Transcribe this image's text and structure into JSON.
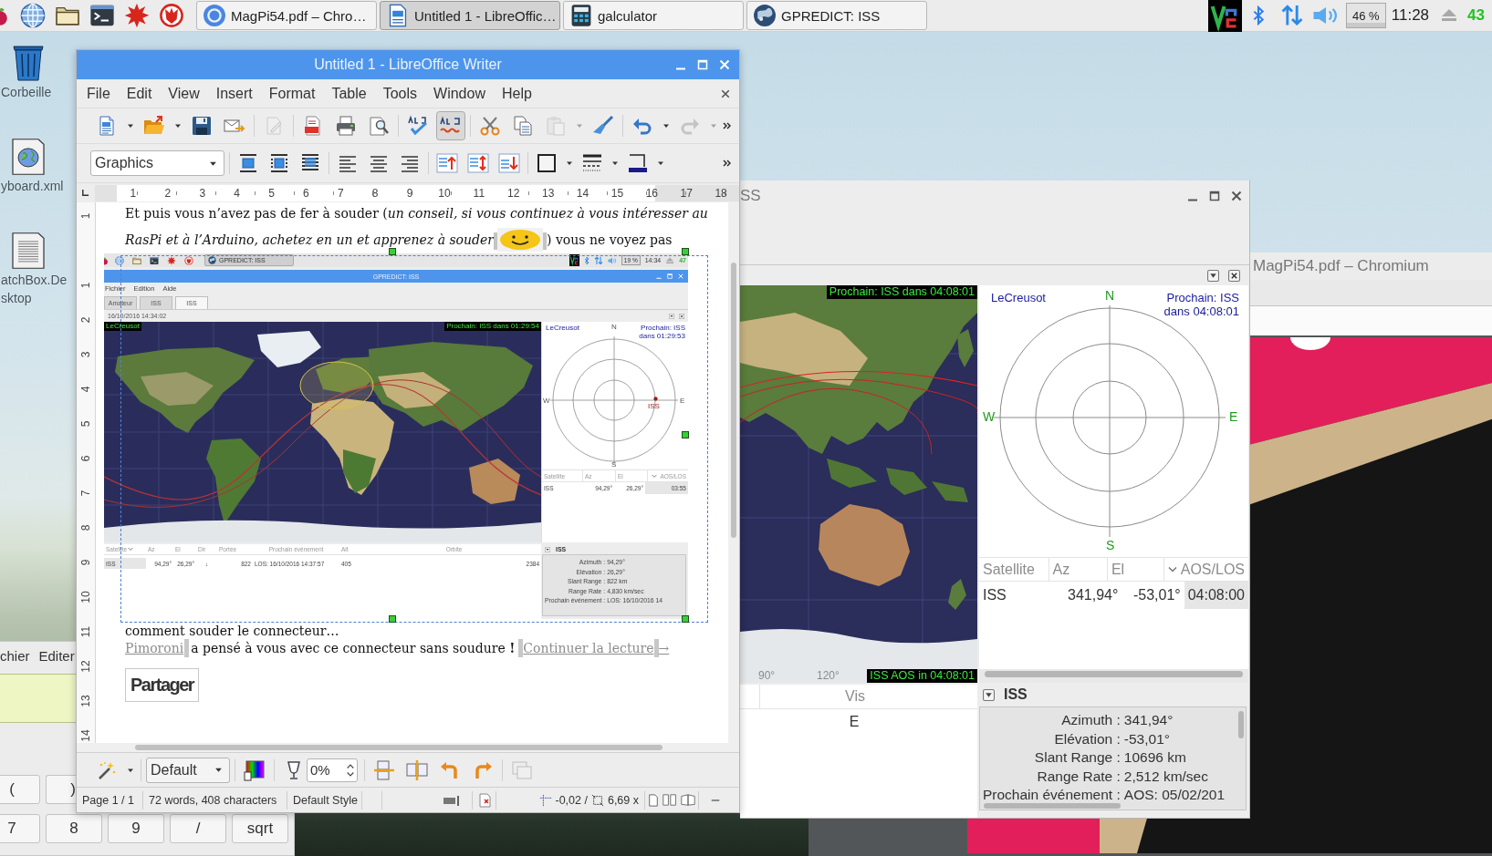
{
  "taskbar": {
    "tasks": [
      {
        "label": "MagPi54.pdf – Chro…",
        "selected": false
      },
      {
        "label": "Untitled 1 - LibreOffic…",
        "selected": true
      },
      {
        "label": "galculator",
        "selected": false
      },
      {
        "label": "GPREDICT: ISS",
        "selected": false
      }
    ],
    "cpu_usage": "46 %",
    "clock": "11:28",
    "temperature": "43"
  },
  "desktop_icons": [
    {
      "lines": [
        "Corbeille"
      ]
    },
    {
      "lines": [
        "yboard.xml"
      ]
    },
    {
      "lines": [
        "atchBox.De",
        "sktop"
      ]
    }
  ],
  "calculator": {
    "menu": [
      "chier",
      "Editer"
    ],
    "key_rows": [
      [
        "(",
        ")"
      ],
      [
        "7",
        "8",
        "9",
        "/",
        "sqrt"
      ]
    ]
  },
  "chromium": {
    "title": "MagPi54.pdf – Chromium"
  },
  "gpredict": {
    "title": "SS",
    "map": {
      "next_pass": "Prochain: ISS dans 04:08:01",
      "aos": "ISS AOS in 04:08:01",
      "longitudes": [
        "90°",
        "120°"
      ]
    },
    "polar": {
      "location": "LeCreusot",
      "next_pass": [
        "Prochain: ISS",
        "dans 04:08:01"
      ],
      "compass": {
        "north": "N",
        "west": "W",
        "east": "E",
        "south": "S"
      }
    },
    "table": {
      "columns": [
        {
          "label": "Satellite",
          "sorted": false
        },
        {
          "label": "Az",
          "sorted": false
        },
        {
          "label": "El",
          "sorted": false
        },
        {
          "label": "AOS/LOS",
          "sorted": true
        }
      ],
      "rows": [
        [
          "ISS",
          "341,94°",
          "-53,01°",
          "04:08:00"
        ]
      ]
    },
    "list": {
      "columns": [
        "Vis"
      ],
      "rows": [
        [
          "E"
        ]
      ]
    },
    "details": {
      "title": "ISS",
      "rows": [
        {
          "label": "Azimuth :",
          "value": "341,94°"
        },
        {
          "label": "Elévation :",
          "value": "-53,01°"
        },
        {
          "label": "Slant Range :",
          "value": "10696 km"
        },
        {
          "label": "Range Rate :",
          "value": "2,512 km/sec"
        },
        {
          "label": "Prochain événement :",
          "value": "AOS: 05/02/201"
        }
      ]
    }
  },
  "writer": {
    "title": "Untitled 1 - LibreOffice Writer",
    "menu": [
      "File",
      "Edit",
      "View",
      "Insert",
      "Format",
      "Table",
      "Tools",
      "Window",
      "Help"
    ],
    "standard_toolbar": {
      "edit_disabled": true,
      "auto_spellcheck": true,
      "paste_disabled": true,
      "redo_disabled": true
    },
    "paragraph_style": "Graphics",
    "ruler": [
      "1",
      "2",
      "3",
      "4",
      "5",
      "6",
      "7",
      "8",
      "9",
      "10",
      "11",
      "12",
      "13",
      "14",
      "15",
      "16",
      "17",
      "18"
    ],
    "vertical_ruler": [
      "1",
      "1",
      "2",
      "3",
      "4",
      "5",
      "6",
      "7",
      "8",
      "9",
      "10",
      "11",
      "12",
      "13",
      "14"
    ],
    "document": {
      "intro": "Et puis vous n’avez pas de fer à souder (*un conseil, si vous continuez à vous intéresser au*",
      "emoji_line": {
        "before": "RasPi et à l’Arduino, achetez en un et apprenez à souder",
        "after": ") vous ne voyez pas"
      },
      "screenshot": {
        "taskbar": {
          "task": "GPREDICT: ISS",
          "cpu_usage": "19 %",
          "clock": "14:34",
          "temperature": "47"
        },
        "title": "GPREDICT: ISS",
        "menu": [
          "Fichier",
          "Edition",
          "Aide"
        ],
        "tabs": [
          {
            "label": "Amateur",
            "selected": false
          },
          {
            "label": "ISS",
            "selected": false
          },
          {
            "label": "ISS",
            "selected": true
          }
        ],
        "timestamp": "16/10/2016 14:34:02",
        "map": {
          "location": "LeCreusot",
          "next_pass": "Prochain: ISS dans 01:29:54"
        },
        "polar": {
          "location": "LeCreusot",
          "next_pass": [
            "Prochain: ISS",
            "dans 01:29:53"
          ],
          "compass": {
            "north": "N",
            "west": "W",
            "east": "E",
            "south": "S"
          },
          "satellite": "ISS"
        },
        "table": {
          "columns": [
            {
              "label": "Satellite",
              "sorted": false
            },
            {
              "label": "Az",
              "sorted": false
            },
            {
              "label": "El",
              "sorted": false
            },
            {
              "label": "AOS/LOS",
              "sorted": true
            }
          ],
          "rows": [
            [
              "ISS",
              "94,29°",
              "26,29°",
              "03:55"
            ]
          ]
        },
        "list": {
          "columns": [
            {
              "label": "Satellite",
              "sorted": true
            },
            {
              "label": "Az",
              "sorted": false
            },
            {
              "label": "El",
              "sorted": false
            },
            {
              "label": "Dir",
              "sorted": false
            },
            {
              "label": "Portée",
              "sorted": false
            },
            {
              "label": "Prochain événement",
              "sorted": false
            },
            {
              "label": "Alt",
              "sorted": false
            },
            {
              "label": "Orbite",
              "sorted": false
            }
          ],
          "rows": [
            [
              "ISS",
              "94,29°",
              "26,29°",
              "↓",
              "822",
              "LOS: 16/10/2016 14:37:57",
              "405",
              "2384"
            ]
          ]
        },
        "details": {
          "title": "ISS",
          "rows": [
            {
              "label": "Azimuth :",
              "value": "94,29°"
            },
            {
              "label": "Elévation :",
              "value": "26,29°"
            },
            {
              "label": "Slant Range :",
              "value": "822 km"
            },
            {
              "label": "Range Rate :",
              "value": "4,830 km/sec"
            },
            {
              "label": "Prochain événement :",
              "value": "LOS: 16/10/2016 14"
            }
          ]
        }
      },
      "caption": "comment souder le connecteur…",
      "closing": {
        "link": "Pimoroni",
        "text": "a pensé à vous avec ce connecteur sans soudure **!**",
        "read_more": "Continuer la lecture",
        "arrow": "→"
      },
      "share_button": "Partager"
    },
    "image_toolbar": {
      "area_style": "Default",
      "transparency": "0%",
      "crop_disabled": true
    },
    "status_bar": {
      "page": "Page 1 / 1",
      "counts": "72 words, 408 characters",
      "page_style": "Default Style",
      "position": "-0,02 /",
      "size": "6,69 x"
    }
  }
}
